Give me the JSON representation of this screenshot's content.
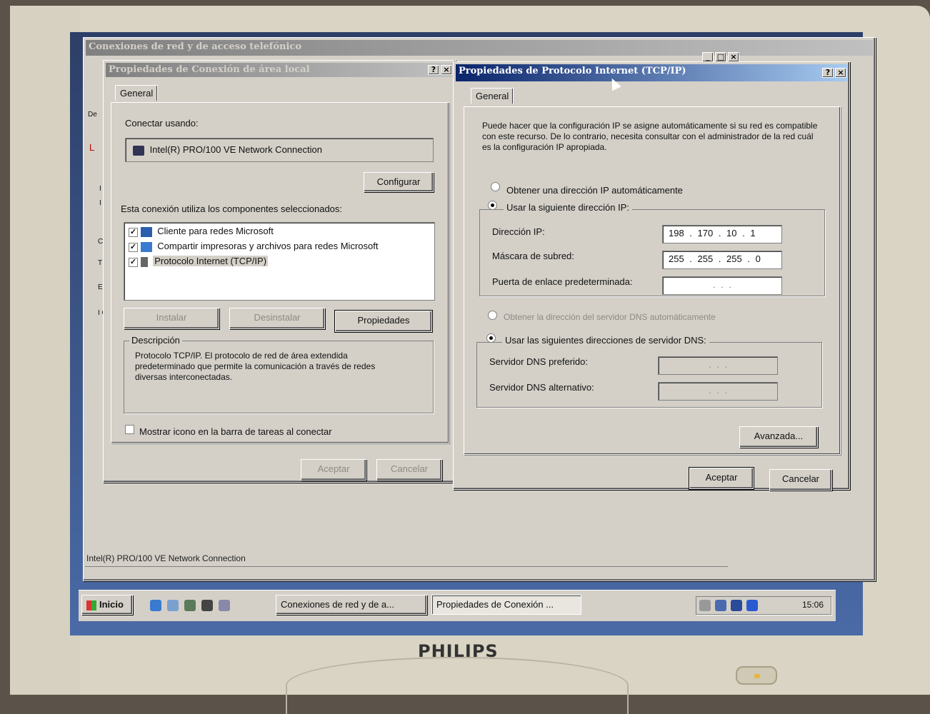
{
  "monitor": {
    "brand": "PHILIPS"
  },
  "bg_window": {
    "title": "Conexiones de red y de acceso telefónico",
    "status_text": "Intel(R) PRO/100 VE Network Connection",
    "side_letters": [
      "De",
      "L",
      "I",
      "I",
      "C",
      "T",
      "E",
      "I C"
    ]
  },
  "lan_dialog": {
    "title": "Propiedades de Conexión de área local",
    "tab": "General",
    "connect_using_label": "Conectar usando:",
    "adapter_name": "Intel(R) PRO/100 VE Network Connection",
    "configure_button": "Configurar",
    "components_label": "Esta conexión utiliza los componentes seleccionados:",
    "components": [
      {
        "label": "Cliente para redes Microsoft",
        "checked": true,
        "icon": "network-client-icon"
      },
      {
        "label": "Compartir impresoras y archivos para redes Microsoft",
        "checked": true,
        "icon": "file-sharing-icon"
      },
      {
        "label": "Protocolo Internet (TCP/IP)",
        "checked": true,
        "icon": "protocol-icon"
      }
    ],
    "install_button": "Instalar",
    "uninstall_button": "Desinstalar",
    "properties_button": "Propiedades",
    "description_group": "Descripción",
    "description_text": "Protocolo TCP/IP. El protocolo de red de área extendida predeterminado que permite la comunicación a través de redes diversas interconectadas.",
    "show_icon_label": "Mostrar icono en la barra de tareas al conectar",
    "show_icon_checked": false,
    "ok_button": "Aceptar",
    "cancel_button": "Cancelar"
  },
  "tcpip_dialog": {
    "title": "Propiedades de Protocolo Internet (TCP/IP)",
    "tab": "General",
    "intro_text": "Puede hacer que la configuración IP se asigne automáticamente si su red es compatible con este recurso. De lo contrario, necesita consultar con el administrador de la red cuál es la configuración IP apropiada.",
    "auto_ip_label": "Obtener una dirección IP automáticamente",
    "manual_ip_label": "Usar la siguiente dirección IP:",
    "ip_label": "Dirección IP:",
    "ip_value": "198 . 170 . 10 . 1",
    "mask_label": "Máscara de subred:",
    "mask_value": "255 . 255 . 255 . 0",
    "gateway_label": "Puerta de enlace predeterminada:",
    "gateway_value": ".     .     .",
    "auto_dns_label": "Obtener la dirección del servidor DNS automáticamente",
    "manual_dns_label": "Usar las siguientes direcciones de servidor DNS:",
    "preferred_dns_label": "Servidor DNS preferido:",
    "preferred_dns_value": ".     .     .",
    "alternate_dns_label": "Servidor DNS alternativo:",
    "alternate_dns_value": ".     .     .",
    "advanced_button": "Avanzada...",
    "ok_button": "Aceptar",
    "cancel_button": "Cancelar"
  },
  "taskbar": {
    "start_label": "Inicio",
    "tasks": [
      "Conexiones de red y de a...",
      "Propiedades de Conexión ..."
    ],
    "clock": "15:06"
  }
}
